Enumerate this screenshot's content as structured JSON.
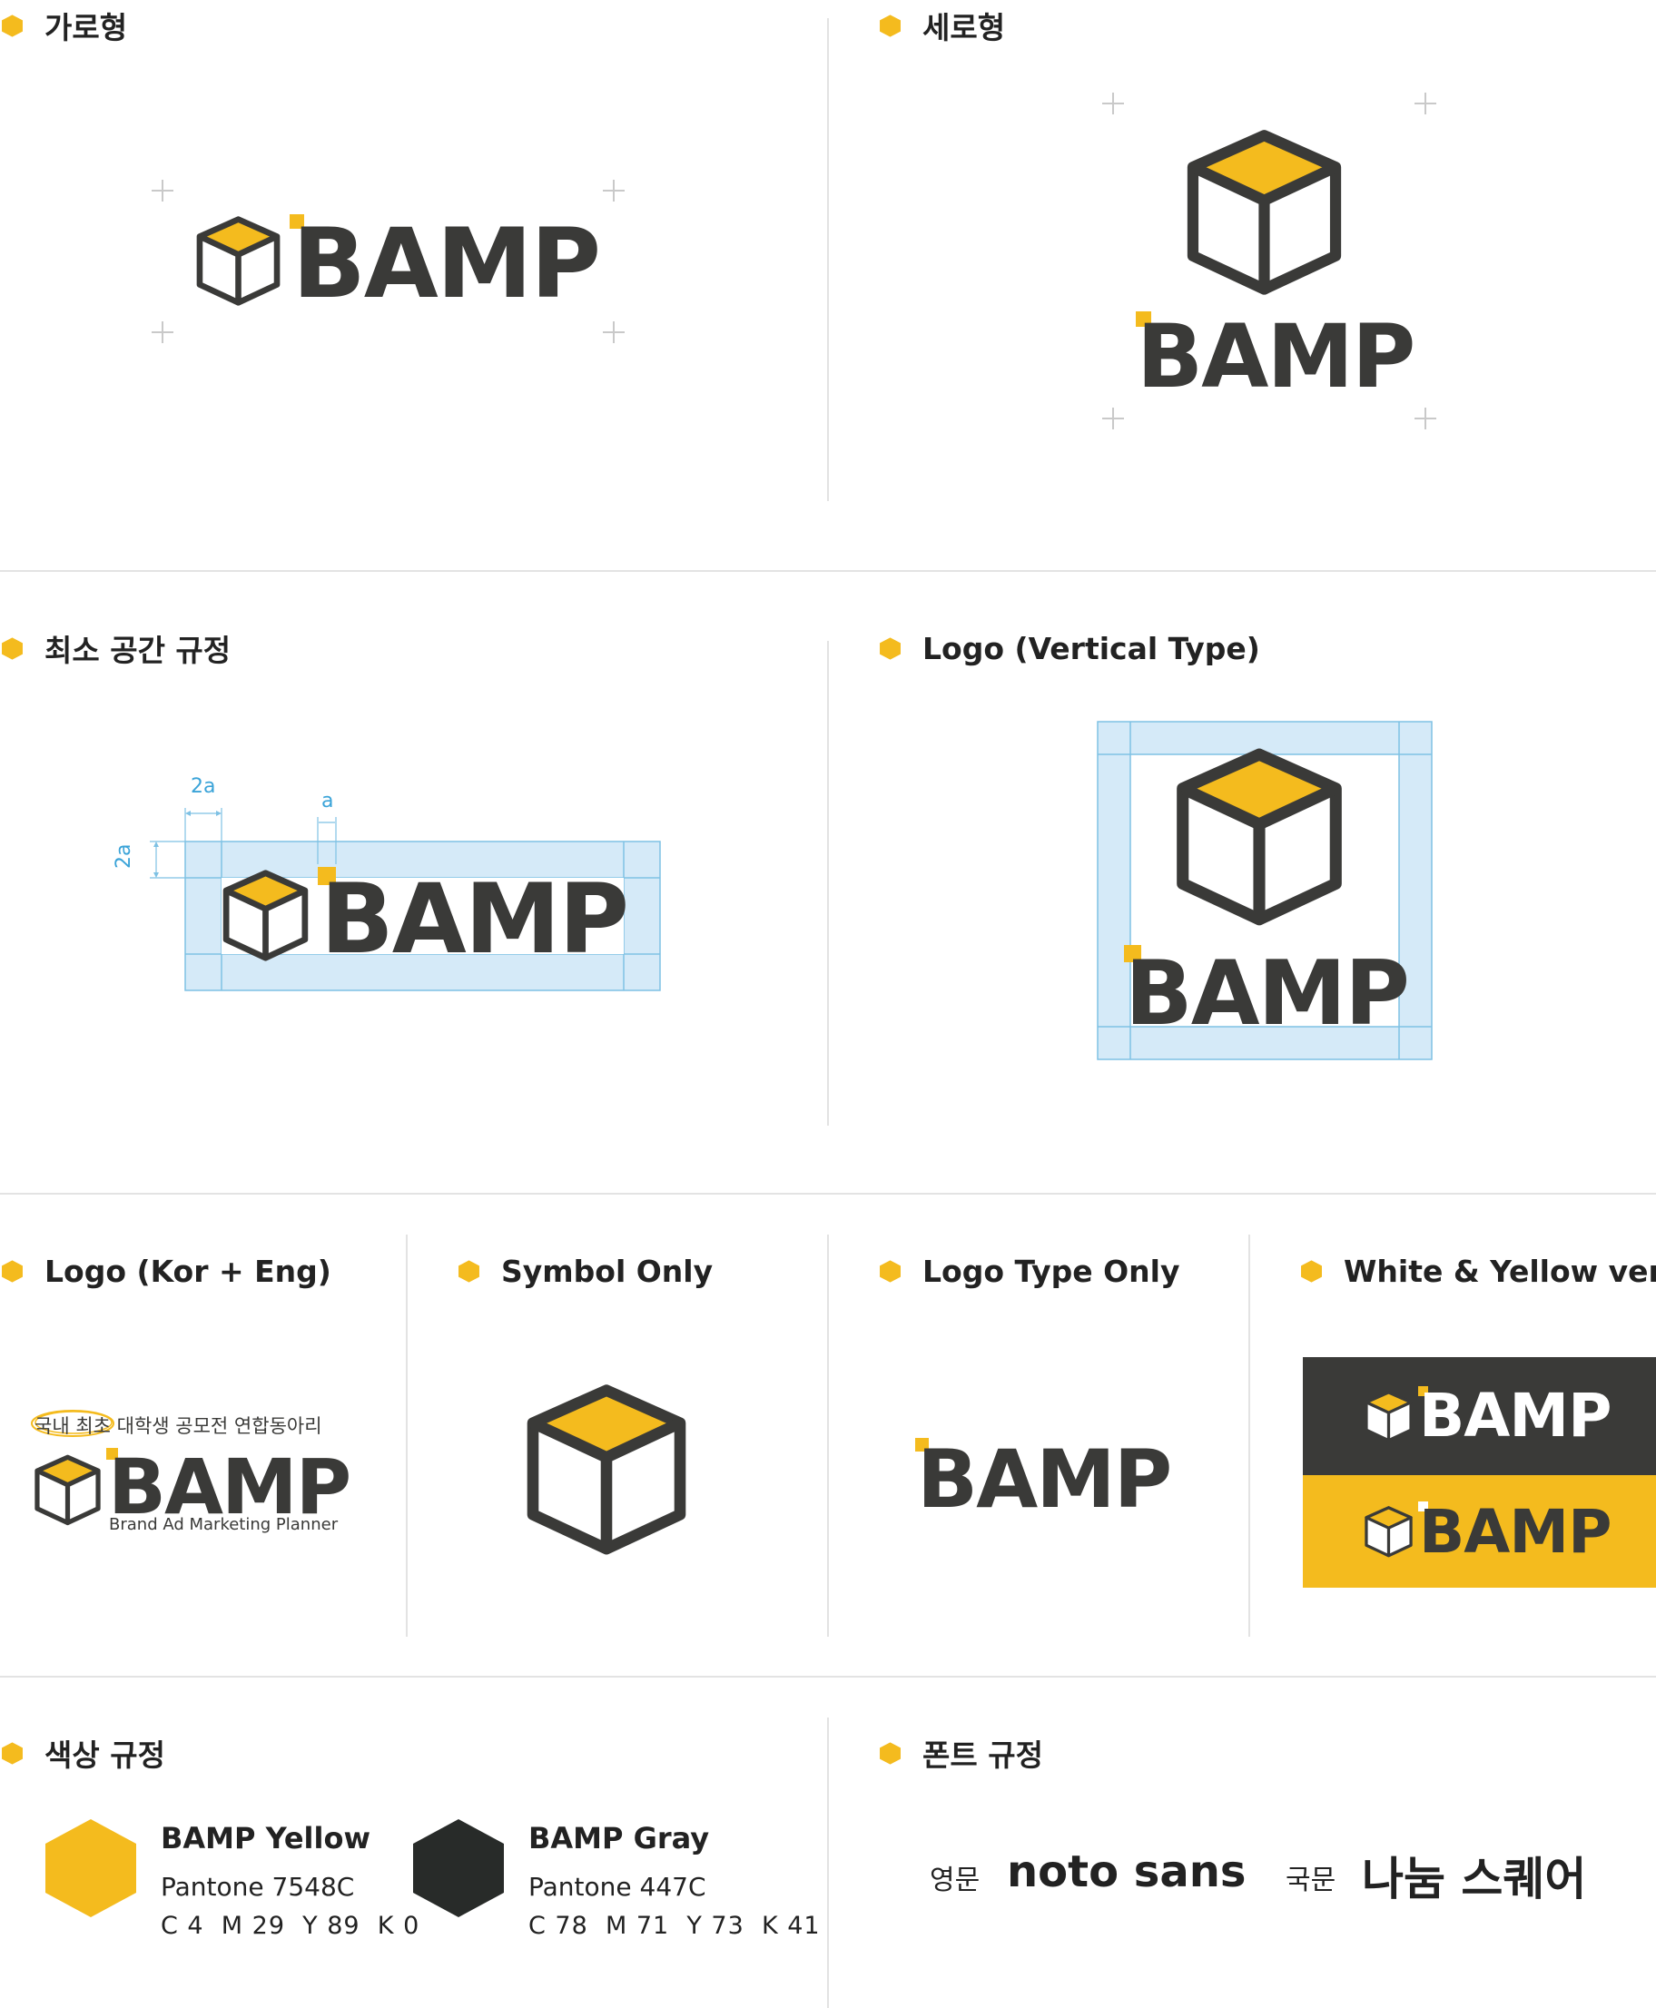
{
  "sections": {
    "horizontal": "가로형",
    "vertical": "세로형",
    "min_space": "최소 공간 규정",
    "logo_vertical_type": "Logo (Vertical Type)",
    "logo_kor_eng": "Logo (Kor + Eng)",
    "symbol_only": "Symbol Only",
    "logo_type_only": "Logo Type Only",
    "white_yellow": "White & Yellow ver",
    "color_rules": "색상 규정",
    "font_rules": "폰트 규정"
  },
  "wordmark": "BAMP",
  "spacing": {
    "label_2a_top": "2a",
    "label_a": "a",
    "label_2a_side": "2a"
  },
  "kor_eng": {
    "tagline_highlight": "국내 최초",
    "tagline_rest": "대학생 공모전 연합동아리",
    "subtitle": "Brand Ad Marketing Planner"
  },
  "colors": {
    "yellow": {
      "name": "BAMP Yellow",
      "pantone": "Pantone 7548C",
      "cmyk": "C 4  M 29  Y 89  K 0",
      "hex": "#f4bb1e"
    },
    "gray": {
      "name": "BAMP Gray",
      "pantone": "Pantone 447C",
      "cmyk": "C 78  M 71  Y 73  K 41",
      "hex": "#282b29"
    }
  },
  "fonts": {
    "eng_label": "영문",
    "eng_font": "noto sans",
    "kor_label": "국문",
    "kor_font": "나눔 스퀘어"
  },
  "palette": {
    "accent": "#f4bb1e",
    "dark": "#3a3a38",
    "guide_fill": "#d5eaf8",
    "guide_line": "#7ec1e4"
  }
}
